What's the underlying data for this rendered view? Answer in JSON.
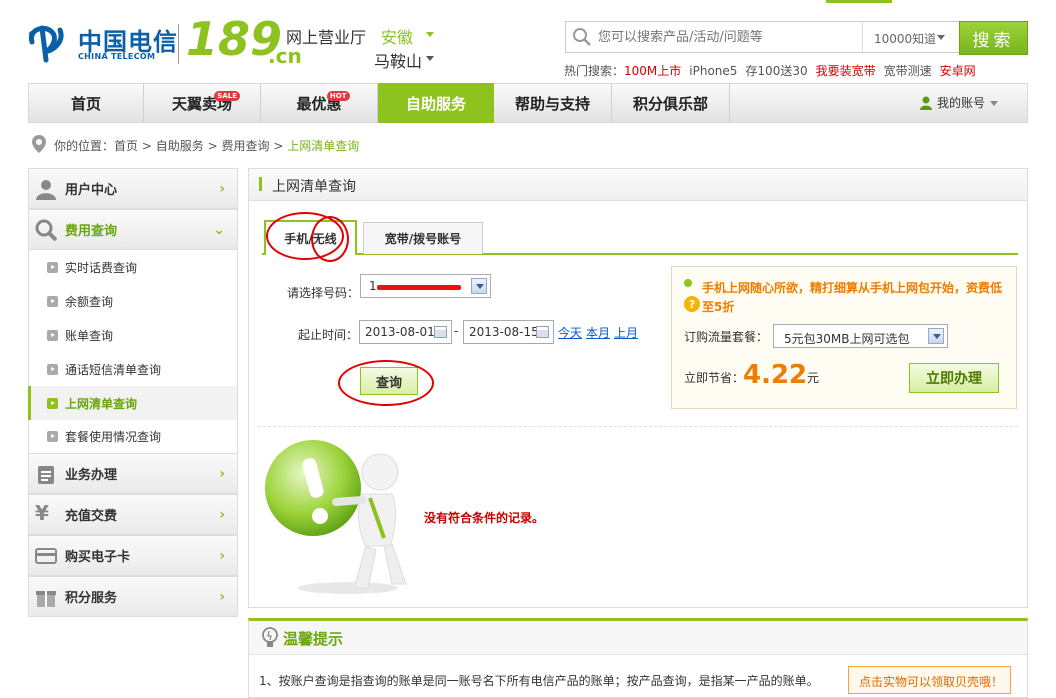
{
  "header": {
    "logo_cn": "中国电信",
    "logo_en": "CHINA TELECOM",
    "num189": "189",
    "dot_cn": ".cn",
    "hall": "网上营业厅",
    "province": "安徽",
    "city": "马鞍山",
    "search_placeholder": "您可以搜索产品/活动/问题等",
    "knowledge": "10000知道",
    "search_btn": "搜索",
    "hot_label": "热门搜索：",
    "hot_items": [
      "100M上市",
      "iPhone5",
      "存100送30",
      "我要装宽带",
      "宽带测速",
      "安卓网"
    ]
  },
  "nav": {
    "items": [
      "首页",
      "天翼卖场",
      "最优惠",
      "自助服务",
      "帮助与支持",
      "积分俱乐部"
    ],
    "badges": {
      "sale": "SALE",
      "hot": "HOT"
    },
    "account": "我的账号"
  },
  "breadcrumb": {
    "prefix": "你的位置：",
    "items": [
      "首页",
      "自助服务",
      "费用查询",
      "上网清单查询"
    ],
    "sep": ">"
  },
  "sidebar": {
    "sections": [
      "用户中心",
      "费用查询",
      "业务办理",
      "充值交费",
      "购买电子卡",
      "积分服务"
    ],
    "subitems": [
      "实时话费查询",
      "余额查询",
      "账单查询",
      "通话短信清单查询",
      "上网清单查询",
      "套餐使用情况查询"
    ]
  },
  "main": {
    "title": "上网清单查询",
    "tabs": [
      "手机/无线",
      "宽带/拨号账号"
    ],
    "number_label": "请选择号码：",
    "number_value": "1",
    "date_label": "起止时间：",
    "date_start": "2013-08-01",
    "date_sep": "-",
    "date_end": "2013-08-15",
    "quick_links": [
      "今天",
      "本月",
      "上月"
    ],
    "query_btn": "查询",
    "no_result": "没有符合条件的记录。"
  },
  "promo": {
    "text": "手机上网随心所欲，精打细算从手机上网包开始，资费低至5折",
    "package_label": "订购流量套餐：",
    "package_value": "5元包30MB上网可选包",
    "save_label": "立即节省：",
    "price": "4.22",
    "unit": "元",
    "apply_btn": "立即办理"
  },
  "tips": {
    "title": "温馨提示",
    "line1": "1、按账户查询是指查询的账单是同一账号名下所有电信产品的账单；按产品查询，是指某一产品的账单。",
    "box": "点击实物可以领取贝壳哦！"
  },
  "colors": {
    "accent": "#8dc21f",
    "brand_blue": "#0a5fa9",
    "orange": "#f07c00",
    "annotation_red": "#e00000"
  }
}
